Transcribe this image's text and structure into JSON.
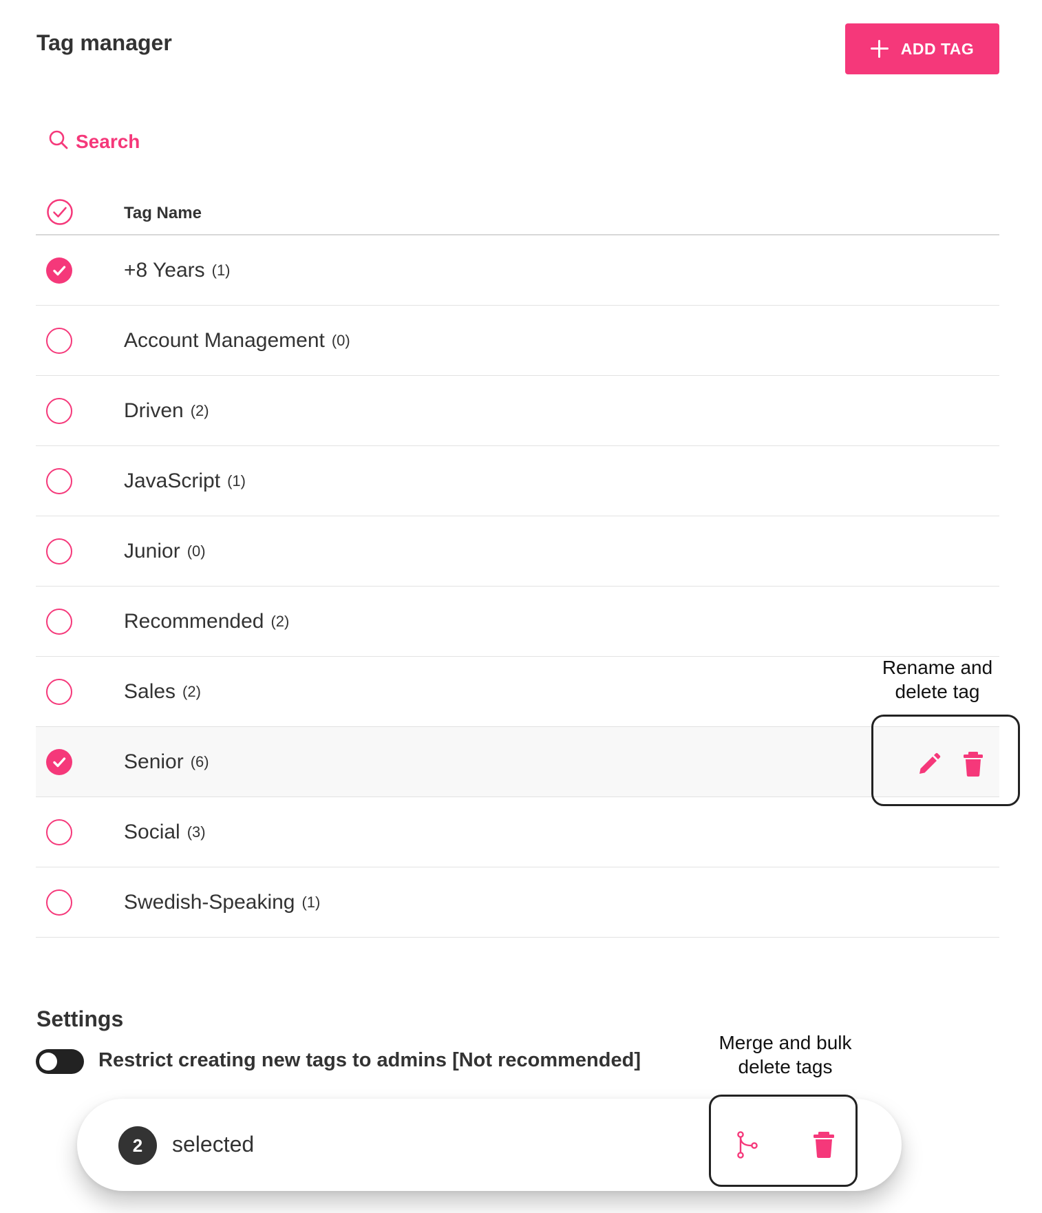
{
  "header": {
    "title": "Tag manager",
    "add_button_label": "ADD TAG"
  },
  "search": {
    "label": "Search"
  },
  "table": {
    "column_name": "Tag Name",
    "rows": [
      {
        "name": "+8 Years",
        "count": "(1)",
        "selected": true
      },
      {
        "name": "Account Management",
        "count": "(0)",
        "selected": false
      },
      {
        "name": "Driven",
        "count": "(2)",
        "selected": false
      },
      {
        "name": "JavaScript",
        "count": "(1)",
        "selected": false
      },
      {
        "name": "Junior",
        "count": "(0)",
        "selected": false
      },
      {
        "name": "Recommended",
        "count": "(2)",
        "selected": false
      },
      {
        "name": "Sales",
        "count": "(2)",
        "selected": false
      },
      {
        "name": "Senior",
        "count": "(6)",
        "selected": true
      },
      {
        "name": "Social",
        "count": "(3)",
        "selected": false
      },
      {
        "name": "Swedish-Speaking",
        "count": "(1)",
        "selected": false
      }
    ]
  },
  "annotations": {
    "row_actions_line1": "Rename and",
    "row_actions_line2": "delete tag",
    "bulk_actions_line1": "Merge and bulk",
    "bulk_actions_line2": "delete tags"
  },
  "settings": {
    "title": "Settings",
    "restrict_label": "Restrict creating new tags to admins [Not recommended]",
    "restrict_enabled": false
  },
  "selection_bar": {
    "count": "2",
    "label": "selected"
  },
  "colors": {
    "accent": "#f5387a",
    "dark": "#222222",
    "text": "#333333"
  },
  "icons": {
    "add": "plus-icon",
    "search": "search-icon",
    "select_all": "check-circle-outline-icon",
    "checked": "check-circle-filled-icon",
    "unchecked": "circle-outline-icon",
    "rename": "pencil-icon",
    "delete": "trash-icon",
    "merge": "merge-icon"
  }
}
